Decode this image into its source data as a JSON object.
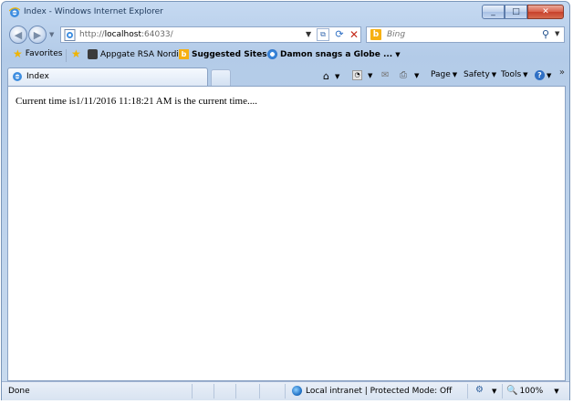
{
  "window": {
    "title": "Index - Windows Internet Explorer",
    "caption_buttons": {
      "minimize": "_",
      "maximize": "□",
      "close": "✕"
    }
  },
  "address_bar": {
    "url_prefix": "http://",
    "url_host": "localhost",
    "url_rest": ":64033/"
  },
  "search": {
    "placeholder": "Bing"
  },
  "favorites_bar": {
    "favorites_label": "Favorites",
    "items": [
      {
        "label": "Appgate RSA Nordic"
      },
      {
        "label": "Suggested Sites"
      },
      {
        "label": "Damon snags a Globe ..."
      }
    ]
  },
  "tabs": [
    {
      "label": "Index"
    }
  ],
  "command_bar": {
    "page": "Page",
    "safety": "Safety",
    "tools": "Tools",
    "help": "?"
  },
  "content": {
    "message": "Current time is1/11/2016 11:18:21 AM is the current time...."
  },
  "status_bar": {
    "status_text": "Done",
    "zone_text": "Local intranet | Protected Mode: Off",
    "zoom": "100%"
  },
  "icons": {
    "back": "back-arrow-icon",
    "forward": "forward-arrow-icon",
    "refresh": "refresh-icon",
    "stop": "stop-icon",
    "search": "search-icon",
    "home": "home-icon",
    "feeds": "rss-feed-icon",
    "mail": "mail-icon",
    "print": "print-icon"
  }
}
